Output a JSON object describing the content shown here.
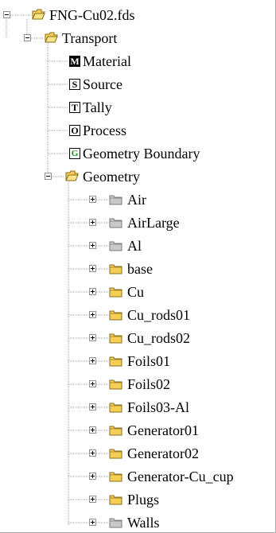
{
  "colors": {
    "folder_yellow": "#f5cf55",
    "folder_gray": "#c9c9c9",
    "tree_line": "#a0a0a0",
    "badge_green": "#10a010"
  },
  "tree": {
    "root": {
      "label": "FNG-Cu02.fds",
      "icon": "folder-open-icon",
      "expanded": true
    },
    "transport": {
      "label": "Transport",
      "icon": "folder-open-icon",
      "expanded": true
    },
    "items": [
      {
        "badge": "M",
        "label": "Material",
        "badge_style": "inverse"
      },
      {
        "badge": "S",
        "label": "Source",
        "badge_style": "outlined"
      },
      {
        "badge": "T",
        "label": "Tally",
        "badge_style": "outlined"
      },
      {
        "badge": "O",
        "label": "Process",
        "badge_style": "outlined"
      },
      {
        "badge": "G",
        "label": "Geometry Boundary",
        "badge_style": "green"
      }
    ],
    "geometry": {
      "label": "Geometry",
      "icon": "folder-open-icon",
      "expanded": true
    },
    "geometry_children": [
      {
        "label": "Air",
        "folder_color": "gray"
      },
      {
        "label": "AirLarge",
        "folder_color": "gray"
      },
      {
        "label": "Al",
        "folder_color": "gray"
      },
      {
        "label": "base",
        "folder_color": "yellow"
      },
      {
        "label": "Cu",
        "folder_color": "yellow"
      },
      {
        "label": "Cu_rods01",
        "folder_color": "yellow"
      },
      {
        "label": "Cu_rods02",
        "folder_color": "yellow"
      },
      {
        "label": "Foils01",
        "folder_color": "yellow"
      },
      {
        "label": "Foils02",
        "folder_color": "yellow"
      },
      {
        "label": "Foils03-Al",
        "folder_color": "yellow"
      },
      {
        "label": "Generator01",
        "folder_color": "yellow"
      },
      {
        "label": "Generator02",
        "folder_color": "yellow"
      },
      {
        "label": "Generator-Cu_cup",
        "folder_color": "yellow"
      },
      {
        "label": "Plugs",
        "folder_color": "yellow"
      },
      {
        "label": "Walls",
        "folder_color": "gray"
      }
    ]
  }
}
